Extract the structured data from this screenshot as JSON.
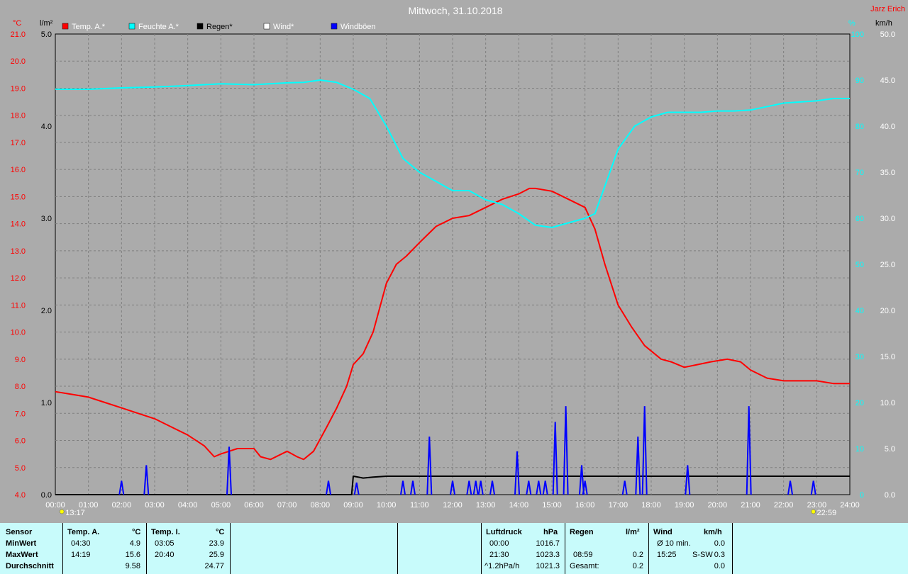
{
  "header": {
    "title": "Mittwoch, 31.10.2018",
    "station": "Jarz Erich",
    "unit_temp": "°C",
    "unit_rain": "l/m²",
    "unit_humidity": "%",
    "unit_wind": "km/h"
  },
  "legend": [
    {
      "label": "Temp. A.*",
      "color": "#ff0000"
    },
    {
      "label": "Feuchte A.*",
      "color": "#00ffff"
    },
    {
      "label": "Regen*",
      "color": "#000000"
    },
    {
      "label": "Wind*",
      "color": "#ffffff"
    },
    {
      "label": "Windböen",
      "color": "#0000ff"
    }
  ],
  "markers": {
    "sunrise": "13:17",
    "sunset": "22:59"
  },
  "chart_data": {
    "type": "line",
    "title": "Mittwoch, 31.10.2018",
    "x_ticks": [
      "00:00",
      "01:00",
      "02:00",
      "03:00",
      "04:00",
      "05:00",
      "06:00",
      "07:00",
      "08:00",
      "09:00",
      "10:00",
      "11:00",
      "12:00",
      "13:00",
      "14:00",
      "15:00",
      "16:00",
      "17:00",
      "18:00",
      "19:00",
      "20:00",
      "21:00",
      "22:00",
      "23:00",
      "24:00"
    ],
    "axes": {
      "temp": {
        "label": "°C",
        "min": 4.0,
        "max": 21.0,
        "ticks": [
          "21.0",
          "20.0",
          "19.0",
          "18.0",
          "17.0",
          "16.0",
          "15.0",
          "14.0",
          "13.0",
          "12.0",
          "11.0",
          "10.0",
          "9.0",
          "8.0",
          "7.0",
          "6.0",
          "5.0",
          "4.0"
        ]
      },
      "rain": {
        "label": "l/m²",
        "min": 0.0,
        "max": 5.0,
        "ticks": [
          "5.0",
          "4.0",
          "3.0",
          "2.0",
          "1.0",
          "0.0"
        ]
      },
      "humidity": {
        "label": "%",
        "min": 0,
        "max": 100,
        "ticks": [
          "100",
          "90",
          "80",
          "70",
          "60",
          "50",
          "40",
          "30",
          "20",
          "10",
          "0"
        ]
      },
      "wind": {
        "label": "km/h",
        "min": 0.0,
        "max": 50.0,
        "ticks": [
          "50.0",
          "45.0",
          "40.0",
          "35.0",
          "30.0",
          "25.0",
          "20.0",
          "15.0",
          "10.0",
          "5.0",
          "0.0"
        ]
      }
    },
    "grid": true,
    "series": [
      {
        "name": "Temp. A.*",
        "axis": "temp",
        "color": "#ff0000",
        "points": [
          [
            0,
            7.8
          ],
          [
            0.5,
            7.7
          ],
          [
            1,
            7.6
          ],
          [
            1.5,
            7.4
          ],
          [
            2,
            7.2
          ],
          [
            2.5,
            7.0
          ],
          [
            3,
            6.8
          ],
          [
            3.5,
            6.5
          ],
          [
            4,
            6.2
          ],
          [
            4.5,
            5.8
          ],
          [
            4.8,
            5.4
          ],
          [
            5,
            5.5
          ],
          [
            5.5,
            5.7
          ],
          [
            6,
            5.7
          ],
          [
            6.2,
            5.4
          ],
          [
            6.5,
            5.3
          ],
          [
            7,
            5.6
          ],
          [
            7.3,
            5.4
          ],
          [
            7.5,
            5.3
          ],
          [
            7.8,
            5.6
          ],
          [
            8.2,
            6.5
          ],
          [
            8.5,
            7.2
          ],
          [
            8.8,
            8.0
          ],
          [
            9,
            8.8
          ],
          [
            9.3,
            9.2
          ],
          [
            9.6,
            10.0
          ],
          [
            10,
            11.8
          ],
          [
            10.3,
            12.5
          ],
          [
            10.6,
            12.8
          ],
          [
            11,
            13.3
          ],
          [
            11.5,
            13.9
          ],
          [
            12,
            14.2
          ],
          [
            12.5,
            14.3
          ],
          [
            13,
            14.6
          ],
          [
            13.5,
            14.9
          ],
          [
            14,
            15.1
          ],
          [
            14.32,
            15.3
          ],
          [
            14.5,
            15.3
          ],
          [
            15,
            15.2
          ],
          [
            15.5,
            14.9
          ],
          [
            16,
            14.6
          ],
          [
            16.3,
            13.8
          ],
          [
            16.6,
            12.5
          ],
          [
            17,
            11.0
          ],
          [
            17.4,
            10.2
          ],
          [
            17.8,
            9.5
          ],
          [
            18.3,
            9.0
          ],
          [
            18.6,
            8.9
          ],
          [
            19,
            8.7
          ],
          [
            19.4,
            8.8
          ],
          [
            19.8,
            8.9
          ],
          [
            20.3,
            9.0
          ],
          [
            20.7,
            8.9
          ],
          [
            21,
            8.6
          ],
          [
            21.5,
            8.3
          ],
          [
            22,
            8.2
          ],
          [
            22.5,
            8.2
          ],
          [
            23,
            8.2
          ],
          [
            23.5,
            8.1
          ],
          [
            24,
            8.1
          ]
        ]
      },
      {
        "name": "Feuchte A.*",
        "axis": "humidity",
        "color": "#00ffff",
        "points": [
          [
            0,
            88
          ],
          [
            1,
            88
          ],
          [
            2,
            88.3
          ],
          [
            3,
            88.5
          ],
          [
            4,
            88.8
          ],
          [
            5,
            89.2
          ],
          [
            6,
            89
          ],
          [
            7,
            89.4
          ],
          [
            7.5,
            89.5
          ],
          [
            8,
            90
          ],
          [
            8.5,
            89.5
          ],
          [
            9,
            88
          ],
          [
            9.5,
            86
          ],
          [
            10,
            80
          ],
          [
            10.5,
            73
          ],
          [
            11,
            70
          ],
          [
            11.5,
            68
          ],
          [
            12,
            66
          ],
          [
            12.5,
            66
          ],
          [
            13,
            64
          ],
          [
            13.5,
            63
          ],
          [
            14,
            61
          ],
          [
            14.5,
            58.5
          ],
          [
            14.8,
            58.2
          ],
          [
            15,
            58
          ],
          [
            15.5,
            59
          ],
          [
            16,
            60
          ],
          [
            16.3,
            61
          ],
          [
            16.6,
            67
          ],
          [
            17,
            75
          ],
          [
            17.5,
            80
          ],
          [
            18,
            82
          ],
          [
            18.5,
            83
          ],
          [
            19,
            83
          ],
          [
            19.5,
            83
          ],
          [
            20,
            83.3
          ],
          [
            20.5,
            83.3
          ],
          [
            21,
            83.5
          ],
          [
            22,
            85
          ],
          [
            23,
            85.5
          ],
          [
            23.5,
            86
          ],
          [
            24,
            86
          ]
        ]
      },
      {
        "name": "Regen*",
        "axis": "rain",
        "color": "#000000",
        "points": [
          [
            0,
            0
          ],
          [
            8.95,
            0
          ],
          [
            9.0,
            0.2
          ],
          [
            9.3,
            0.18
          ],
          [
            9.6,
            0.19
          ],
          [
            10,
            0.2
          ],
          [
            24,
            0.2
          ]
        ]
      },
      {
        "name": "Windböen",
        "axis": "wind",
        "color": "#0000ff",
        "spikes": [
          [
            2.0,
            1.5
          ],
          [
            2.75,
            3.2
          ],
          [
            5.25,
            5.2
          ],
          [
            8.25,
            1.5
          ],
          [
            9.1,
            1.3
          ],
          [
            10.5,
            1.5
          ],
          [
            10.8,
            1.5
          ],
          [
            11.3,
            6.3
          ],
          [
            12.0,
            1.5
          ],
          [
            12.5,
            1.5
          ],
          [
            12.7,
            1.5
          ],
          [
            12.85,
            1.5
          ],
          [
            13.2,
            1.5
          ],
          [
            13.95,
            4.7
          ],
          [
            14.3,
            1.5
          ],
          [
            14.6,
            1.5
          ],
          [
            14.8,
            1.5
          ],
          [
            15.1,
            7.9
          ],
          [
            15.42,
            9.6
          ],
          [
            15.9,
            3.2
          ],
          [
            16.0,
            1.5
          ],
          [
            17.2,
            1.5
          ],
          [
            17.6,
            6.3
          ],
          [
            17.8,
            9.6
          ],
          [
            19.1,
            3.2
          ],
          [
            20.95,
            9.6
          ],
          [
            22.2,
            1.5
          ],
          [
            22.9,
            1.5
          ]
        ]
      }
    ]
  },
  "stats": {
    "sensor": {
      "header": "Sensor",
      "rows": [
        "MinWert",
        "MaxWert",
        "Durchschnitt"
      ]
    },
    "temp_a": {
      "header": "Temp. A.",
      "unit": "°C",
      "times": [
        "04:30",
        "14:19",
        ""
      ],
      "values": [
        "4.9",
        "15.6",
        "9.58"
      ]
    },
    "temp_i": {
      "header": "Temp. I.",
      "unit": "°C",
      "times": [
        "03:05",
        "20:40",
        ""
      ],
      "values": [
        "23.9",
        "25.9",
        "24.77"
      ]
    },
    "pressure": {
      "header": "Luftdruck",
      "unit": "hPa",
      "times": [
        "00:00",
        "21:30",
        "^1.2hPa/h"
      ],
      "values": [
        "1016.7",
        "1023.3",
        "1021.3"
      ]
    },
    "rain": {
      "header": "Regen",
      "unit": "l/m²",
      "times": [
        "",
        "08:59",
        "Gesamt:"
      ],
      "values": [
        "",
        "0.2",
        "0.2"
      ]
    },
    "wind": {
      "header": "Wind",
      "unit": "km/h",
      "times": [
        "Ø 10 min.",
        "15:25",
        ""
      ],
      "dirs": [
        "",
        "S-SW",
        ""
      ],
      "values": [
        "0.0",
        "0.3",
        "0.0"
      ]
    }
  }
}
